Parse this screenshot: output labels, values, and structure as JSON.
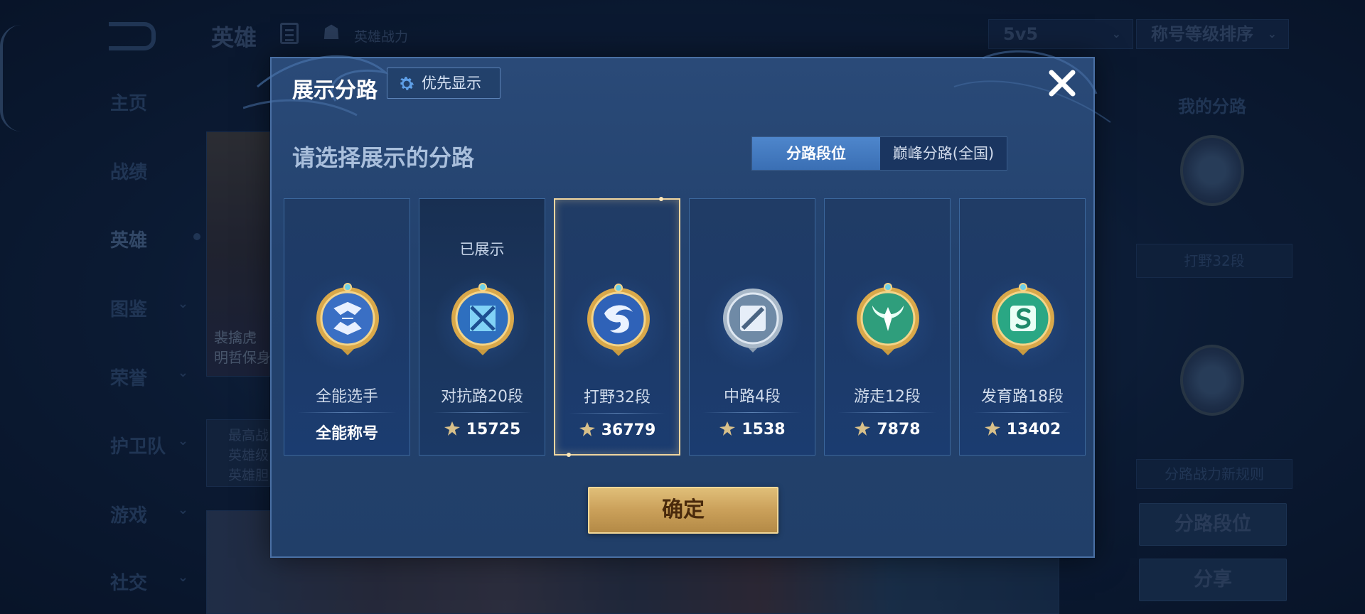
{
  "background": {
    "title": "英雄",
    "power_label": "英雄战力",
    "mode_select": "5v5",
    "sort_select": "称号等级排序",
    "nav": [
      "主页",
      "战绩",
      "英雄",
      "图鉴",
      "荣誉",
      "护卫队",
      "游戏",
      "社交"
    ],
    "card_text_top": "裴擒虎\n明哲保身",
    "card_text_bottom": "最高战\n英雄级\n英雄胆",
    "right_panel": {
      "label": "我的分路",
      "badge_label": "打野32段",
      "rule_label": "分路战力新规则",
      "rank_button": "分路段位",
      "share_button": "分享"
    }
  },
  "modal": {
    "title": "展示分路",
    "priority_button": "优先显示",
    "section_title": "请选择展示的分路",
    "tabs": [
      {
        "label": "分路段位",
        "active": true
      },
      {
        "label": "巅峰分路(全国)",
        "active": false
      }
    ],
    "lanes": [
      {
        "name": "全能选手",
        "value": "全能称号",
        "shown_tag": "",
        "show_power_icon": false,
        "selected": false,
        "shown": false,
        "badge_color": "#3a6fc4",
        "emblem": "all-round-icon"
      },
      {
        "name": "对抗路20段",
        "value": "15725",
        "shown_tag": "已展示",
        "show_power_icon": true,
        "selected": false,
        "shown": true,
        "badge_color": "#2e6fbf",
        "emblem": "clash-lane-icon"
      },
      {
        "name": "打野32段",
        "value": "36779",
        "shown_tag": "",
        "show_power_icon": true,
        "selected": true,
        "shown": false,
        "badge_color": "#2f62b8",
        "emblem": "jungle-icon"
      },
      {
        "name": "中路4段",
        "value": "1538",
        "shown_tag": "",
        "show_power_icon": true,
        "selected": false,
        "shown": false,
        "badge_color": "#6f8aa6",
        "emblem": "mid-lane-icon"
      },
      {
        "name": "游走12段",
        "value": "7878",
        "shown_tag": "",
        "show_power_icon": true,
        "selected": false,
        "shown": false,
        "badge_color": "#2f9e7c",
        "emblem": "roam-icon"
      },
      {
        "name": "发育路18段",
        "value": "13402",
        "shown_tag": "",
        "show_power_icon": true,
        "selected": false,
        "shown": false,
        "badge_color": "#2aa784",
        "emblem": "farm-lane-icon"
      }
    ],
    "confirm_button": "确定"
  }
}
